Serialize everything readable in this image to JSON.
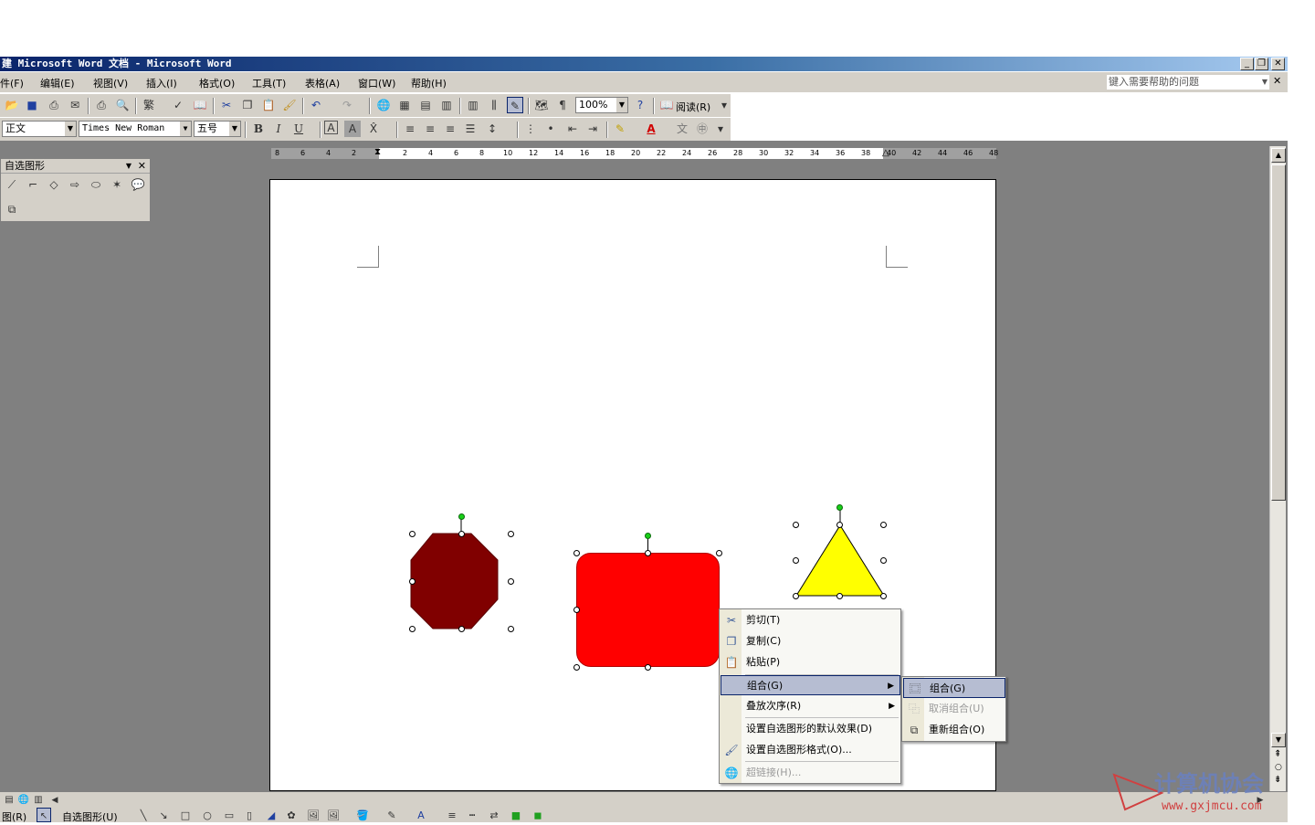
{
  "window": {
    "title": "建 Microsoft Word 文档 - Microsoft Word",
    "controls": [
      "_",
      "❐",
      "✕"
    ]
  },
  "menubar": {
    "items": [
      "件(F)",
      "编辑(E)",
      "视图(V)",
      "插入(I)",
      "格式(O)",
      "工具(T)",
      "表格(A)",
      "窗口(W)",
      "帮助(H)"
    ],
    "help_placeholder": "键入需要帮助的问题",
    "close": "✕"
  },
  "standard_toolbar": {
    "zoom": "100%",
    "read_button": "阅读(R)"
  },
  "formatting_toolbar": {
    "style": "正文",
    "font": "Times New Roman",
    "size": "五号",
    "bold": "B",
    "italic": "I",
    "underline": "U",
    "font_color_letter": "A"
  },
  "ruler": {
    "ticks": [
      "8",
      "6",
      "4",
      "2",
      "2",
      "4",
      "6",
      "8",
      "10",
      "12",
      "14",
      "16",
      "18",
      "20",
      "22",
      "24",
      "26",
      "28",
      "30",
      "32",
      "34",
      "36",
      "38",
      "40",
      "42",
      "44",
      "46",
      "48"
    ]
  },
  "autoshape_palette": {
    "title": "自选图形"
  },
  "shapes": {
    "octagon_color": "#800000",
    "rounded_rect_color": "#ff0000",
    "triangle_color": "#ffff00"
  },
  "context_menu": {
    "items": [
      {
        "label": "剪切(T)",
        "icon": "scissors-icon"
      },
      {
        "label": "复制(C)",
        "icon": "copy-icon"
      },
      {
        "label": "粘贴(P)",
        "icon": "paste-icon"
      },
      {
        "label": "组合(G)",
        "icon": "",
        "submenu": true,
        "selected": true
      },
      {
        "label": "叠放次序(R)",
        "icon": "",
        "submenu": true
      },
      {
        "label": "设置自选图形的默认效果(D)",
        "icon": ""
      },
      {
        "label": "设置自选图形格式(O)...",
        "icon": "format-shape-icon"
      },
      {
        "label": "超链接(H)...",
        "icon": "hyperlink-icon",
        "disabled": true
      }
    ]
  },
  "group_submenu": {
    "items": [
      {
        "label": "组合(G)",
        "selected": true
      },
      {
        "label": "取消组合(U)",
        "disabled": true
      },
      {
        "label": "重新组合(O)"
      }
    ]
  },
  "drawing_toolbar": {
    "draw_menu": "图(R)",
    "autoshapes_menu": "自选图形(U)"
  },
  "watermark": {
    "text": "计算机协会",
    "url": "www.gxjmcu.com"
  }
}
